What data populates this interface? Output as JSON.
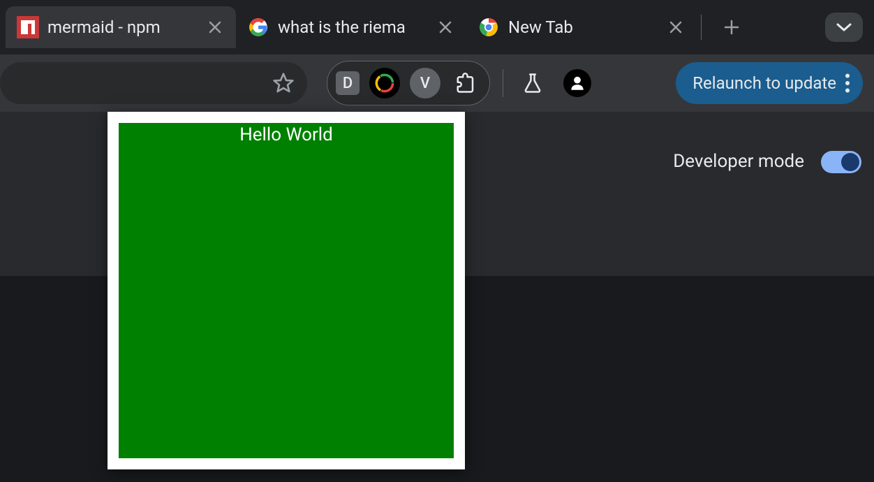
{
  "tabs": [
    {
      "title": "mermaid - npm",
      "favicon": "npm",
      "active": true
    },
    {
      "title": "what is the riema",
      "favicon": "google",
      "active": false
    },
    {
      "title": "New Tab",
      "favicon": "chrome",
      "active": false
    }
  ],
  "toolbar": {
    "ext_label_d": "D",
    "ext_label_v": "V",
    "relaunch_label": "Relaunch to update"
  },
  "dev_mode": {
    "label": "Developer mode",
    "enabled": true
  },
  "popup": {
    "text": "Hello World"
  }
}
